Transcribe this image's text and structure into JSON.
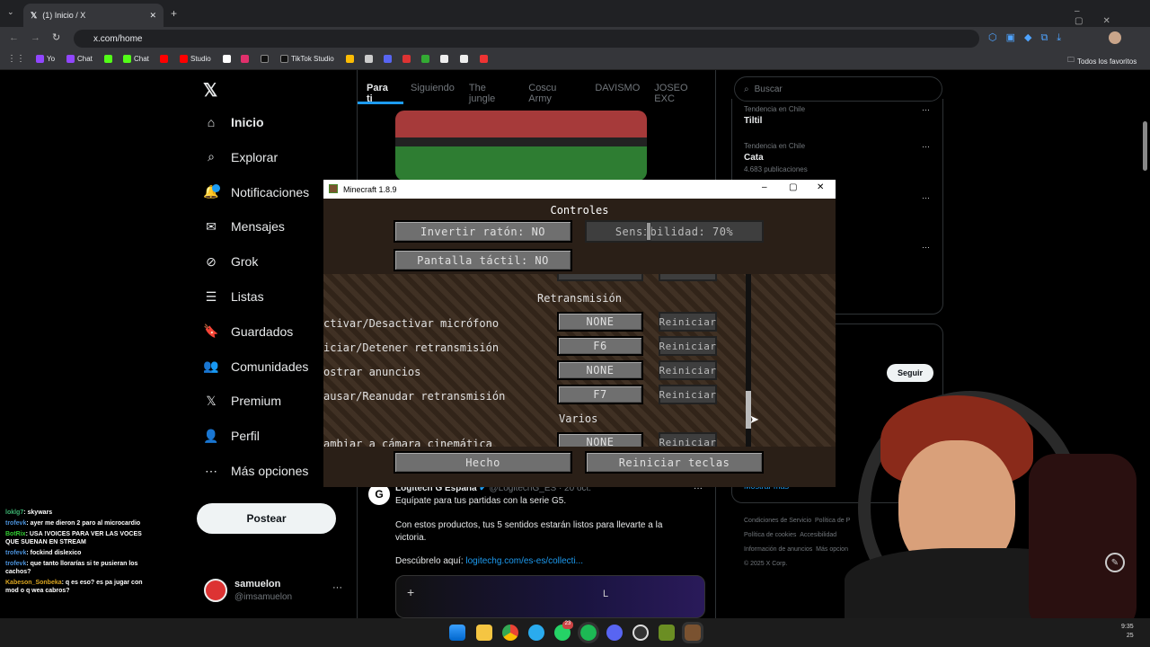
{
  "browser": {
    "tab_title": "(1) Inicio / X",
    "url": "x.com/home",
    "bookmarks": [
      "Yo",
      "Chat",
      "Chat",
      "Studio",
      "TikTok Studio"
    ],
    "all_bookmarks": "Todos los favoritos"
  },
  "x": {
    "nav": [
      {
        "label": "Inicio"
      },
      {
        "label": "Explorar"
      },
      {
        "label": "Notificaciones"
      },
      {
        "label": "Mensajes"
      },
      {
        "label": "Grok"
      },
      {
        "label": "Listas"
      },
      {
        "label": "Guardados"
      },
      {
        "label": "Comunidades"
      },
      {
        "label": "Premium"
      },
      {
        "label": "Perfil"
      },
      {
        "label": "Más opciones"
      }
    ],
    "post_button": "Postear",
    "user": {
      "name": "samuelon",
      "handle": "@imsamuelon"
    },
    "tabs": [
      "Para ti",
      "Siguiendo",
      "The jungle",
      "Coscu Army",
      "DAVISMO",
      "JOSEO EXC"
    ],
    "search_placeholder": "Buscar",
    "trends": [
      {
        "meta": "Tendencia en Chile",
        "name": "Tiltil",
        "count": ""
      },
      {
        "meta": "Tendencia en Chile",
        "name": "Cata",
        "count": "4.683 publicaciones"
      }
    ],
    "follow": "Seguir",
    "show_more": "Mostrar más",
    "footer": [
      "Condiciones de Servicio",
      "Política de P",
      "Política de cookies",
      "Accesibilidad",
      "Información de anuncios",
      "Más opcion",
      "© 2025 X Corp."
    ],
    "post": {
      "author": "Logitech G España",
      "handle": "@LogitechG_ES · 20 oct.",
      "text1": "Equípate para tus partidas con la serie G5.",
      "text2": "Con estos productos, tus 5 sentidos estarán listos para llevarte a la victoria.",
      "link_prefix": "Descúbrelo aquí:",
      "link": "logitechg.com/es-es/collecti..."
    }
  },
  "minecraft": {
    "window_title": "Minecraft 1.8.9",
    "heading": "Controles",
    "invert": "Invertir ratón: NO",
    "sensitivity": "Sensibilidad: 70%",
    "touch": "Pantalla táctil: NO",
    "section_stream": "Retransmisión",
    "section_misc": "Varios",
    "reset": "Reiniciar",
    "rows": [
      {
        "label": "ctivar/Desactivar micrófono",
        "key": "NONE"
      },
      {
        "label": "iciar/Detener retransmisión",
        "key": "F6"
      },
      {
        "label": "ostrar anuncios",
        "key": "NONE"
      },
      {
        "label": "ausar/Reanudar retransmisión",
        "key": "F7"
      },
      {
        "label": "ambiar a cámara cinemática",
        "key": "NONE"
      }
    ],
    "done": "Hecho",
    "reset_keys": "Reiniciar teclas"
  },
  "chat": [
    {
      "user": "loklg7",
      "msg": "skywars",
      "color": "#3cb371"
    },
    {
      "user": "trofevk",
      "msg": "ayer me dieron 2 paro al microcardio",
      "color": "#4a90d9"
    },
    {
      "user": "BotRix",
      "msg": "USA !VOICES PARA VER LAS VOCES QUE SUENAN EN STREAM",
      "color": "#32cd32"
    },
    {
      "user": "trofevk",
      "msg": "fockind dislexico",
      "color": "#4a90d9"
    },
    {
      "user": "trofevk",
      "msg": "que tanto llorarías si te pusieran los cachos?",
      "color": "#4a90d9"
    },
    {
      "user": "Kabeson_Sonbeka",
      "msg": "q es eso? es pa jugar con mod o q wea cabros?",
      "color": "#daa520"
    }
  ],
  "taskbar": {
    "time": "9:35",
    "date": "25"
  }
}
